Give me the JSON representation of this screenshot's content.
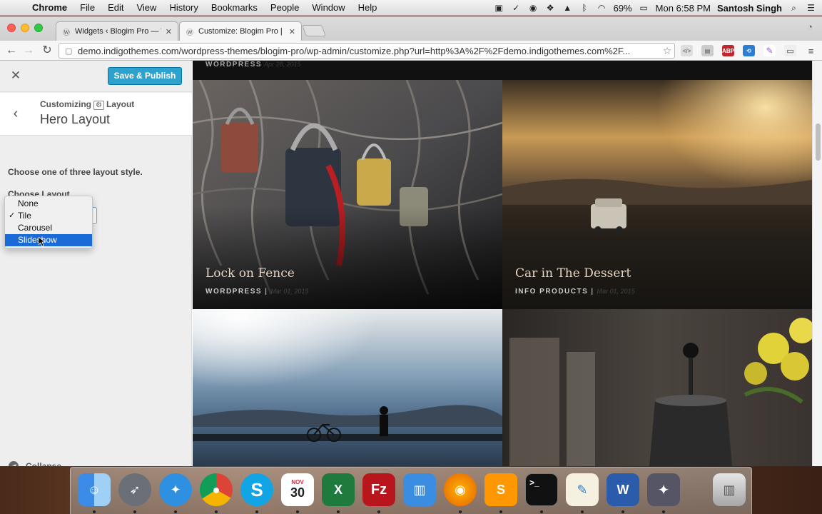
{
  "menubar": {
    "app": "Chrome",
    "items": [
      "File",
      "Edit",
      "View",
      "History",
      "Bookmarks",
      "People",
      "Window",
      "Help"
    ],
    "battery": "69%",
    "clock": "Mon 6:58 PM",
    "user": "Santosh Singh"
  },
  "browser": {
    "tabs": [
      {
        "title": "Widgets ‹ Blogim Pro — W"
      },
      {
        "title": "Customize: Blogim Pro | Th"
      }
    ],
    "url": "demo.indigothemes.com/wordpress-themes/blogim-pro/wp-admin/customize.php?url=http%3A%2F%2Fdemo.indigothemes.com%2F...",
    "extensions": [
      "ABP"
    ]
  },
  "customizer": {
    "save_label": "Save & Publish",
    "breadcrumb_prefix": "Customizing",
    "breadcrumb_section": "Layout",
    "section_title": "Hero Layout",
    "description": "Choose one of three layout style.",
    "choose_label": "Choose Layout",
    "options": [
      "None",
      "Tile",
      "Carousel",
      "Slideshow"
    ],
    "checked_option": "Tile",
    "highlighted_option": "Slideshow",
    "collapse_label": "Collapse"
  },
  "preview": {
    "top_category": "WORDPRESS",
    "top_date": "Apr 28, 2015",
    "posts": [
      {
        "title": "Lock on Fence",
        "category": "WORDPRESS",
        "date": "Mar 01, 2015"
      },
      {
        "title": "Car in The Dessert",
        "category": "INFO PRODUCTS",
        "date": "Mar 01, 2015"
      }
    ]
  },
  "dock": {
    "calendar_month": "NOV",
    "calendar_day": "30"
  }
}
